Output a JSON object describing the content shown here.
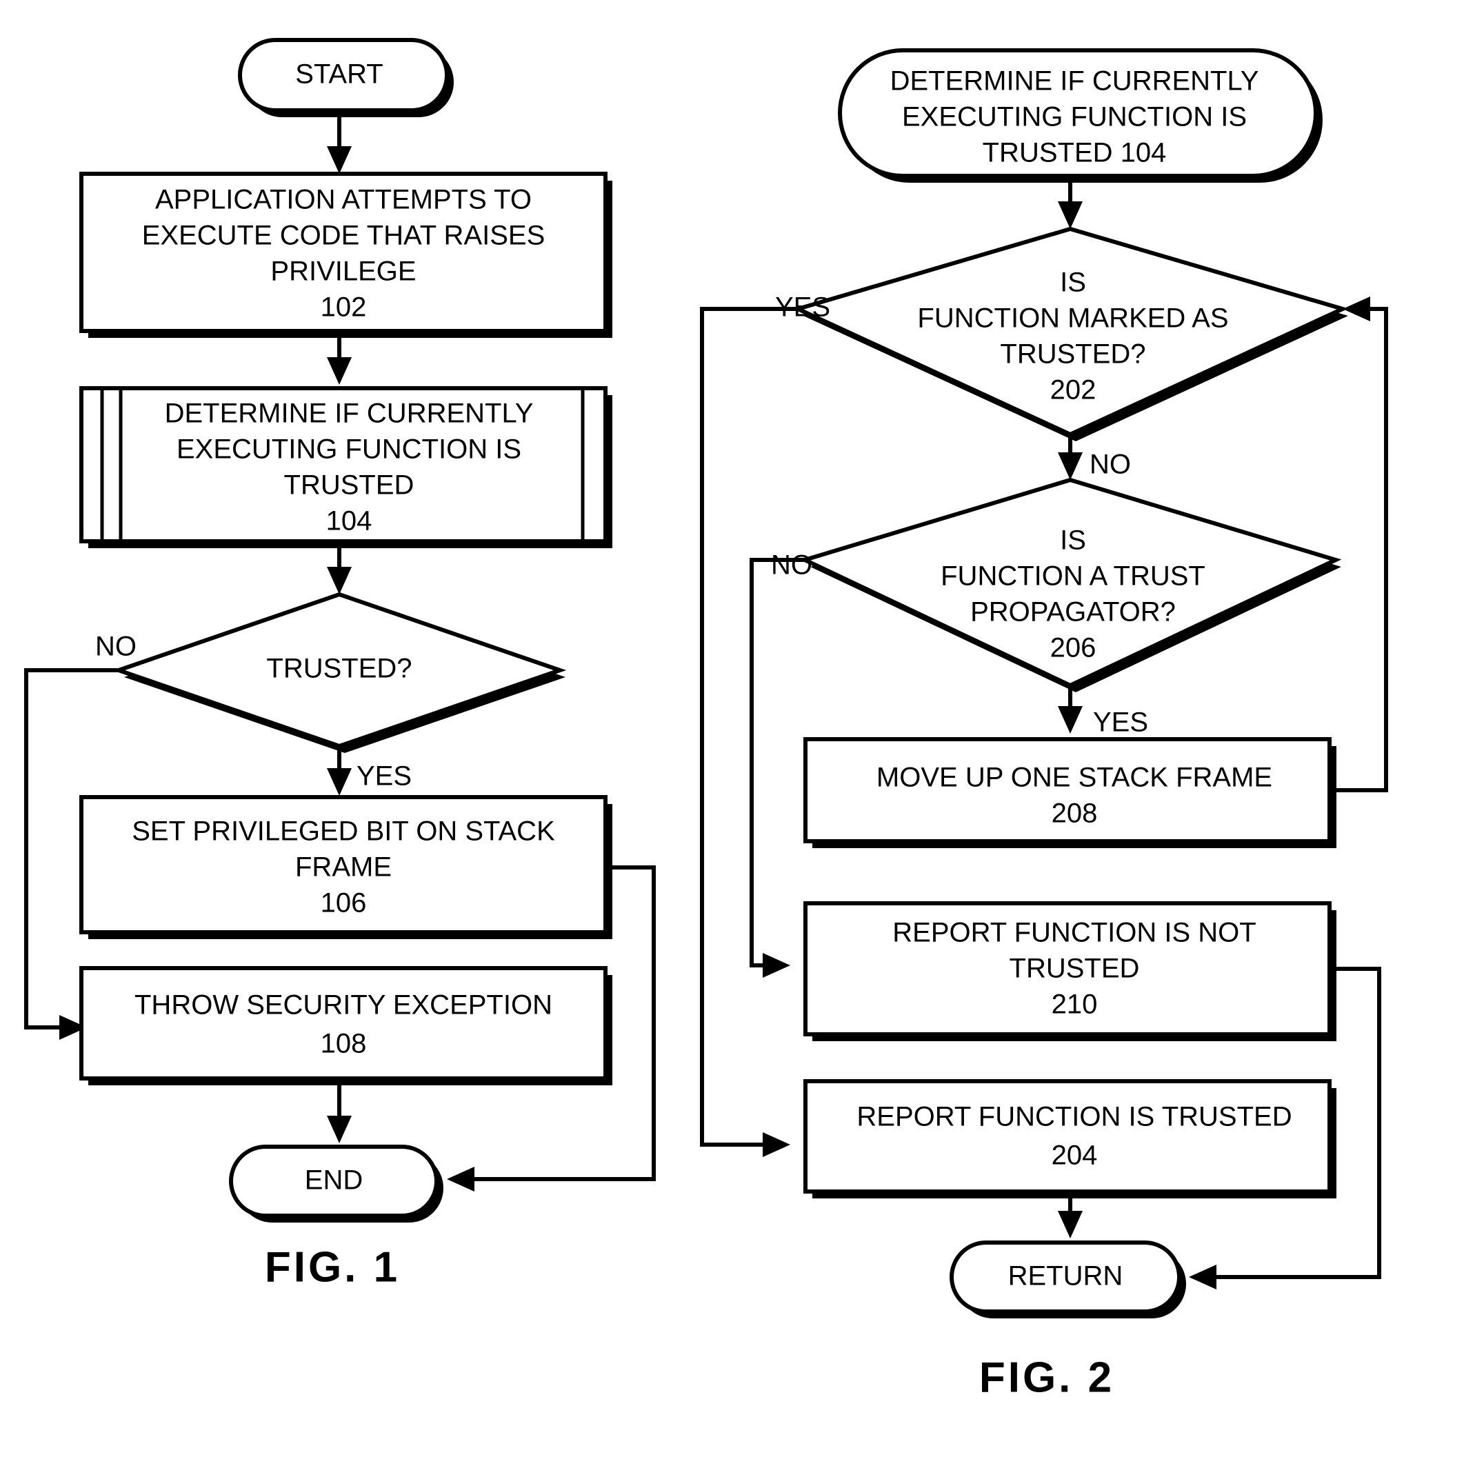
{
  "figures": [
    {
      "id": "fig1",
      "caption": "FIG. 1",
      "nodes": {
        "start": {
          "label": "START",
          "shape": "terminator"
        },
        "step102": {
          "line1": "APPLICATION ATTEMPTS TO",
          "line2": "EXECUTE CODE THAT RAISES",
          "line3": "PRIVILEGE",
          "ref": "102",
          "shape": "process"
        },
        "step104": {
          "line1": "DETERMINE IF CURRENTLY",
          "line2": "EXECUTING FUNCTION IS",
          "line3": "TRUSTED",
          "ref": "104",
          "shape": "predefined-process"
        },
        "decision_trusted": {
          "label": "TRUSTED?",
          "shape": "decision"
        },
        "step106": {
          "line1": "SET PRIVILEGED BIT ON STACK",
          "line2": "FRAME",
          "ref": "106",
          "shape": "process"
        },
        "step108": {
          "line1": "THROW SECURITY EXCEPTION",
          "ref": "108",
          "shape": "process"
        },
        "end": {
          "label": "END",
          "shape": "terminator"
        }
      },
      "edge_labels": {
        "trusted_no": "NO",
        "trusted_yes": "YES"
      }
    },
    {
      "id": "fig2",
      "caption": "FIG. 2",
      "nodes": {
        "entry104": {
          "line1": "DETERMINE IF CURRENTLY",
          "line2": "EXECUTING FUNCTION IS",
          "line3": "TRUSTED  104",
          "shape": "terminator"
        },
        "decision202": {
          "line1": "IS",
          "line2": "FUNCTION MARKED AS",
          "line3": "TRUSTED?",
          "ref": "202",
          "shape": "decision"
        },
        "decision206": {
          "line1": "IS",
          "line2": "FUNCTION A TRUST",
          "line3": "PROPAGATOR?",
          "ref": "206",
          "shape": "decision"
        },
        "step208": {
          "line1": "MOVE UP ONE STACK FRAME",
          "ref": "208",
          "shape": "process"
        },
        "step210": {
          "line1": "REPORT FUNCTION IS NOT",
          "line2": "TRUSTED",
          "ref": "210",
          "shape": "process"
        },
        "step204": {
          "line1": "REPORT FUNCTION IS TRUSTED",
          "ref": "204",
          "shape": "process"
        },
        "return": {
          "label": "RETURN",
          "shape": "terminator"
        }
      },
      "edge_labels": {
        "d202_yes": "YES",
        "d202_no": "NO",
        "d206_no": "NO",
        "d206_yes": "YES"
      }
    }
  ],
  "colors": {
    "line": "#000000",
    "fill": "#ffffff",
    "shadow": "#000000"
  }
}
